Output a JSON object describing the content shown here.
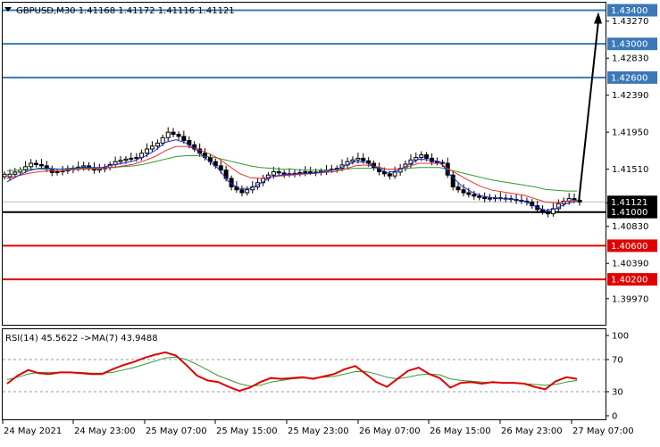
{
  "header": {
    "main": "GBPUSD,M30  1.41168 1.41172 1.41116 1.41121",
    "rsi": "RSI(14) 45.5622  ->MA(7) 43.9488"
  },
  "colors": {
    "candle": "#000000",
    "ma_fast": "#1f2bd6",
    "ma_mid": "#e83030",
    "ma_slow": "#2e9a2e",
    "level_blue": "#3a78b8",
    "level_red": "#e00000",
    "rsi_line": "#e00000",
    "rsi_ma": "#2e9a2e",
    "arrow": "#000000"
  },
  "chart_data": [
    {
      "type": "candlestick",
      "symbol": "GBPUSD",
      "timeframe": "M30",
      "ylim": [
        1.3966,
        1.4349
      ],
      "y_ticks": [
        1.4327,
        1.4283,
        1.4239,
        1.4195,
        1.4151,
        1.4111,
        1.4083,
        1.4039,
        1.3997
      ],
      "y_tick_labels": [
        "1.43270",
        "1.42830",
        "1.42390",
        "1.41950",
        "1.41510",
        "1.41110",
        "1.40830",
        "1.40390",
        "1.39970"
      ],
      "x_tick_labels": [
        "24 May 2021",
        "24 May 23:00",
        "25 May 07:00",
        "25 May 15:00",
        "25 May 23:00",
        "26 May 07:00",
        "26 May 15:00",
        "26 May 23:00",
        "27 May 07:00"
      ],
      "levels": [
        {
          "value": 1.434,
          "label": "1.43400",
          "color": "blue"
        },
        {
          "value": 1.43,
          "label": "1.43000",
          "color": "blue"
        },
        {
          "value": 1.426,
          "label": "1.42600",
          "color": "blue"
        },
        {
          "value": 1.41,
          "label": "1.41000",
          "color": "black"
        },
        {
          "value": 1.406,
          "label": "1.40600",
          "color": "red"
        },
        {
          "value": 1.402,
          "label": "1.40200",
          "color": "red"
        }
      ],
      "current_price": {
        "value": 1.41121,
        "label": "1.41121"
      },
      "close_path": [
        1.4145,
        1.415,
        1.4158,
        1.4155,
        1.4147,
        1.4149,
        1.4152,
        1.4155,
        1.415,
        1.4153,
        1.416,
        1.4163,
        1.4165,
        1.4175,
        1.4182,
        1.4195,
        1.419,
        1.418,
        1.417,
        1.416,
        1.415,
        1.413,
        1.4123,
        1.413,
        1.414,
        1.4148,
        1.4145,
        1.4146,
        1.4148,
        1.4147,
        1.415,
        1.4152,
        1.416,
        1.4164,
        1.4158,
        1.4148,
        1.4143,
        1.4152,
        1.4162,
        1.4168,
        1.416,
        1.4158,
        1.413,
        1.4123,
        1.4119,
        1.4116,
        1.4117,
        1.4116,
        1.4114,
        1.4112,
        1.4103,
        1.4098,
        1.411,
        1.4116,
        1.4112
      ],
      "arrow_target": 1.434,
      "ma_fast": [
        1.4136,
        1.4143,
        1.4149,
        1.4152,
        1.4152,
        1.4151,
        1.4152,
        1.4153,
        1.4153,
        1.4153,
        1.4156,
        1.4158,
        1.4161,
        1.4166,
        1.4173,
        1.4183,
        1.4186,
        1.4182,
        1.4173,
        1.4162,
        1.4152,
        1.4136,
        1.4128,
        1.4128,
        1.4134,
        1.4142,
        1.4144,
        1.4145,
        1.4146,
        1.4146,
        1.4148,
        1.415,
        1.4155,
        1.416,
        1.4159,
        1.4153,
        1.4147,
        1.4149,
        1.4156,
        1.4163,
        1.4162,
        1.416,
        1.4144,
        1.4132,
        1.4124,
        1.4119,
        1.4117,
        1.4116,
        1.4115,
        1.4113,
        1.4107,
        1.4102,
        1.4104,
        1.411,
        1.4113
      ],
      "ma_mid": [
        1.414,
        1.4143,
        1.4146,
        1.4148,
        1.4149,
        1.4149,
        1.415,
        1.4151,
        1.4151,
        1.4152,
        1.4153,
        1.4155,
        1.4157,
        1.4161,
        1.4166,
        1.4173,
        1.4178,
        1.4178,
        1.4175,
        1.417,
        1.4164,
        1.4155,
        1.4146,
        1.4141,
        1.414,
        1.4142,
        1.4143,
        1.4144,
        1.4145,
        1.4146,
        1.4147,
        1.4148,
        1.4151,
        1.4155,
        1.4156,
        1.4154,
        1.4151,
        1.4151,
        1.4154,
        1.4158,
        1.4158,
        1.4158,
        1.415,
        1.4143,
        1.4136,
        1.413,
        1.4126,
        1.4124,
        1.4122,
        1.412,
        1.4116,
        1.4112,
        1.4111,
        1.4113,
        1.4114
      ],
      "ma_slow": [
        1.4149,
        1.415,
        1.4151,
        1.4151,
        1.4151,
        1.4151,
        1.4151,
        1.4152,
        1.4152,
        1.4152,
        1.4153,
        1.4154,
        1.4155,
        1.4157,
        1.416,
        1.4163,
        1.4166,
        1.4167,
        1.4167,
        1.4166,
        1.4164,
        1.4161,
        1.4158,
        1.4155,
        1.4153,
        1.4152,
        1.4151,
        1.4151,
        1.415,
        1.415,
        1.415,
        1.415,
        1.4151,
        1.4152,
        1.4152,
        1.4152,
        1.4151,
        1.4151,
        1.4152,
        1.4153,
        1.4153,
        1.4153,
        1.415,
        1.4147,
        1.4144,
        1.4141,
        1.4138,
        1.4136,
        1.4134,
        1.4132,
        1.413,
        1.4127,
        1.4126,
        1.4125,
        1.4125
      ]
    },
    {
      "type": "line",
      "title": "RSI(14) 45.5622  ->MA(7) 43.9488",
      "ylim": [
        0,
        100
      ],
      "y_ticks": [
        100,
        70,
        30,
        0
      ],
      "y_tick_labels": [
        "100",
        "70",
        "30",
        "0"
      ],
      "rsi": [
        40,
        50,
        57,
        53,
        52,
        54,
        54,
        53,
        52,
        52,
        58,
        63,
        67,
        72,
        76,
        79,
        75,
        63,
        50,
        44,
        42,
        36,
        31,
        35,
        42,
        47,
        46,
        47,
        48,
        46,
        49,
        52,
        58,
        62,
        52,
        42,
        36,
        46,
        56,
        60,
        52,
        47,
        35,
        41,
        42,
        40,
        42,
        41,
        41,
        40,
        36,
        33,
        43,
        48,
        46
      ],
      "rsi_ma": [
        45,
        48,
        52,
        54,
        54,
        54,
        54,
        54,
        53,
        53,
        54,
        57,
        60,
        64,
        68,
        72,
        73,
        70,
        64,
        57,
        50,
        45,
        40,
        37,
        38,
        42,
        44,
        46,
        47,
        47,
        48,
        49,
        52,
        55,
        55,
        52,
        48,
        46,
        48,
        51,
        52,
        51,
        46,
        44,
        43,
        42,
        41,
        41,
        41,
        40,
        39,
        38,
        39,
        42,
        44
      ]
    }
  ]
}
